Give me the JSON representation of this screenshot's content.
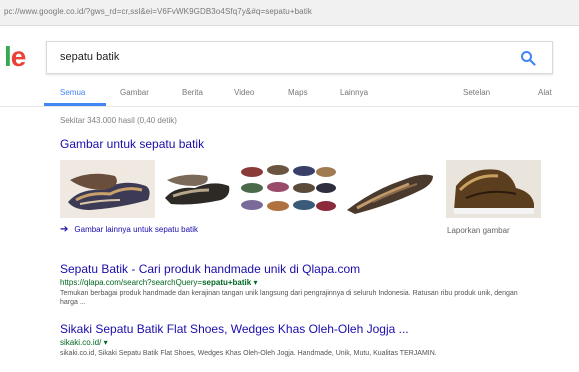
{
  "browser": {
    "url": "pc://www.google.co.id/?gws_rd=cr,ssl&ei=V6FvWK9GDB3o4Sfq7y&#q=sepatu+batik"
  },
  "logo": {
    "part1": "l",
    "part2": "e"
  },
  "search": {
    "query": "sepatu batik",
    "icon": "search-icon"
  },
  "tabs": [
    {
      "label": "Semua",
      "active": true
    },
    {
      "label": "Gambar"
    },
    {
      "label": "Berita"
    },
    {
      "label": "Video"
    },
    {
      "label": "Maps"
    },
    {
      "label": "Lainnya"
    },
    {
      "label": "Setelan"
    },
    {
      "label": "Alat"
    }
  ],
  "stats": "Sekitar 343.000 hasil (0,40 detik)",
  "images": {
    "heading": "Gambar untuk sepatu batik",
    "more_link": "Gambar lainnya untuk sepatu batik",
    "report": "Laporkan gambar"
  },
  "results": [
    {
      "title": "Sepatu Batik - Cari produk handmade unik di Qlapa.com",
      "url_pre": "https://qlapa.com/search?searchQuery=",
      "url_bold": "sepatu+batik",
      "snippet": "Temukan berbagai produk handmade dan kerajinan tangan unik langsung dari pengrajinnya di seluruh Indonesia. Ratusan ribu produk unik, dengan harga ..."
    },
    {
      "title": "Sikaki Sepatu Batik Flat Shoes, Wedges Khas Oleh-Oleh Jogja ...",
      "url_pre": "sikaki.co.id/",
      "url_bold": "",
      "snippet": "sikaki.co.id, Sikaki Sepatu Batik Flat Shoes, Wedges Khas Oleh-Oleh Jogja. Handmade, Unik, Mutu, Kualitas TERJAMIN."
    }
  ]
}
